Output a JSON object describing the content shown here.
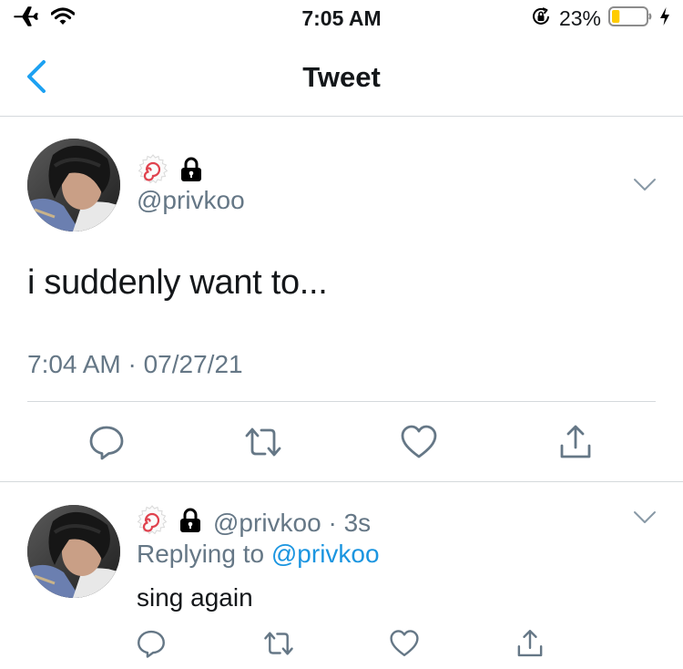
{
  "status_bar": {
    "time": "7:05 AM",
    "battery_percent": "23%",
    "icons": [
      "airplane-icon",
      "wifi-icon",
      "orientation-lock-icon",
      "battery-icon",
      "charging-bolt-icon"
    ],
    "battery_fill_fraction": 0.23,
    "battery_fill_color": "#ffcc00"
  },
  "nav": {
    "title": "Tweet",
    "back_icon": "chevron-left-icon",
    "accent_color": "#1da1f2"
  },
  "main_tweet": {
    "handle": "@privkoo",
    "badges": [
      "fishcake-emoji-icon",
      "lock-icon"
    ],
    "text": "i suddenly want to...",
    "timestamp": "7:04 AM · 07/27/21",
    "actions": [
      "reply-icon",
      "retweet-icon",
      "like-icon",
      "share-icon"
    ]
  },
  "reply_tweet": {
    "handle": "@privkoo",
    "age": "· 3s",
    "replying_prefix": "Replying to",
    "replying_to": "@privkoo",
    "text": "sing again",
    "badges": [
      "fishcake-emoji-icon",
      "lock-icon"
    ],
    "actions": [
      "reply-icon",
      "retweet-icon",
      "like-icon",
      "share-icon"
    ]
  }
}
